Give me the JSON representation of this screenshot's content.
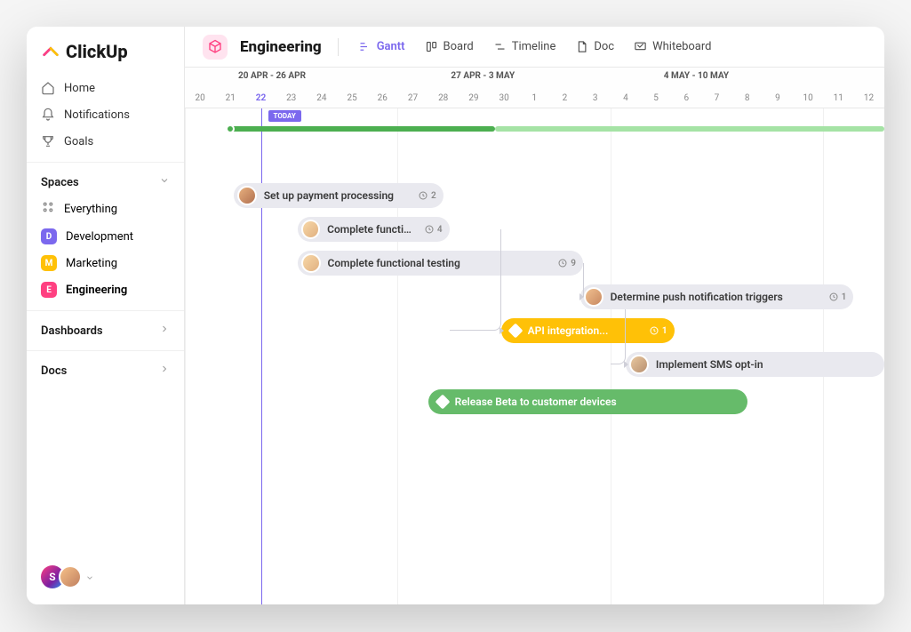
{
  "brand": "ClickUp",
  "nav": {
    "home": "Home",
    "notifications": "Notifications",
    "goals": "Goals"
  },
  "sections": {
    "spaces": "Spaces",
    "dashboards": "Dashboards",
    "docs": "Docs"
  },
  "spacesList": {
    "everything": "Everything",
    "development": {
      "letter": "D",
      "label": "Development"
    },
    "marketing": {
      "letter": "M",
      "label": "Marketing"
    },
    "engineering": {
      "letter": "E",
      "label": "Engineering"
    }
  },
  "sidebarUsers": {
    "initial": "S"
  },
  "page": {
    "title": "Engineering"
  },
  "views": {
    "gantt": "Gantt",
    "board": "Board",
    "timeline": "Timeline",
    "doc": "Doc",
    "whiteboard": "Whiteboard"
  },
  "timeline": {
    "weeks": [
      {
        "label": "20 APR - 26 APR",
        "startCol": 0
      },
      {
        "label": "27 APR - 3 MAY",
        "startCol": 7
      },
      {
        "label": "4 MAY - 10 MAY",
        "startCol": 14
      }
    ],
    "days": [
      "20",
      "21",
      "22",
      "23",
      "24",
      "25",
      "26",
      "27",
      "28",
      "29",
      "30",
      "1",
      "2",
      "3",
      "4",
      "5",
      "6",
      "7",
      "8",
      "9",
      "10",
      "11",
      "12"
    ],
    "todayIndex": 2,
    "todayLabel": "TODAY"
  },
  "tasks": [
    {
      "id": "t1",
      "label": "Set up payment processing",
      "style": "gray",
      "avatar": "av1",
      "count": "2",
      "startCol": 1.6,
      "span": 6.9
    },
    {
      "id": "t2",
      "label": "Complete functio...",
      "style": "gray",
      "avatar": "av2",
      "count": "4",
      "startCol": 3.7,
      "span": 5.0
    },
    {
      "id": "t3",
      "label": "Complete functional testing",
      "style": "gray",
      "avatar": "av2",
      "count": "9",
      "startCol": 3.7,
      "span": 9.4
    },
    {
      "id": "t4",
      "label": "Determine push notification triggers",
      "style": "gray",
      "avatar": "av3",
      "count": "1",
      "startCol": 13.0,
      "span": 9.0
    },
    {
      "id": "t5",
      "label": "API integration...",
      "style": "yellow",
      "diamond": true,
      "count": "1",
      "startCol": 10.4,
      "span": 5.7
    },
    {
      "id": "t6",
      "label": "Implement SMS opt-in",
      "style": "gray",
      "avatar": "av4",
      "startCol": 14.5,
      "span": 8.5
    },
    {
      "id": "t7",
      "label": "Release Beta to customer devices",
      "style": "green",
      "diamond": true,
      "startCol": 8.0,
      "span": 10.5
    }
  ]
}
